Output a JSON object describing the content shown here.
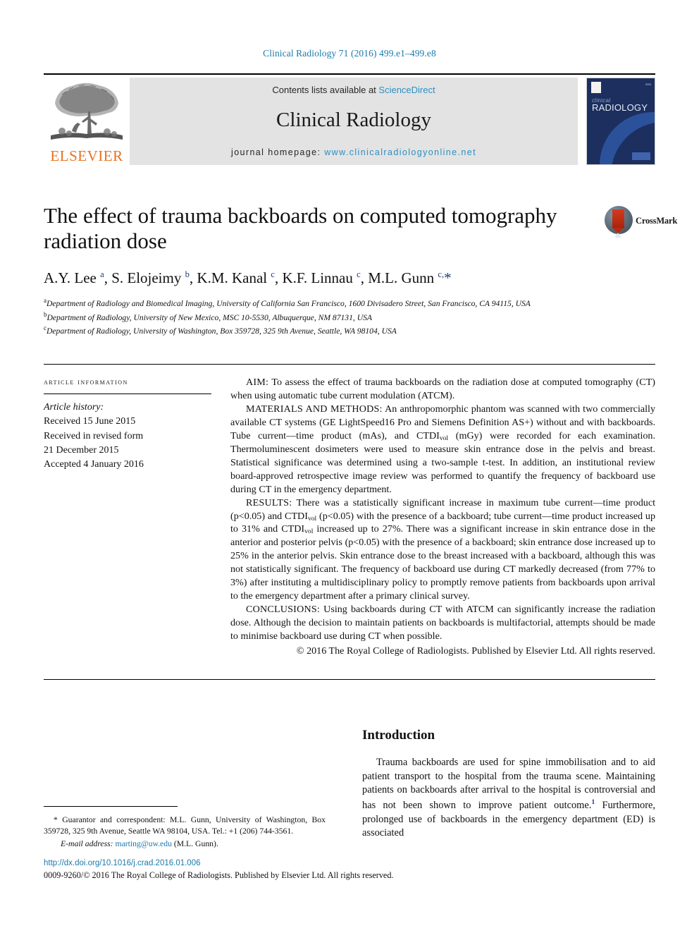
{
  "running_head": "Clinical Radiology 71 (2016) 499.e1–499.e8",
  "masthead": {
    "publisher_name": "ELSEVIER",
    "contents_prefix": "Contents lists available at ",
    "sciencedirect": "ScienceDirect",
    "journal_name": "Clinical Radiology",
    "homepage_prefix": "journal homepage: ",
    "homepage_url": "www.clinicalradiologyonline.net",
    "cover": {
      "title_small": "clinical",
      "title_large": "RADIOLOGY",
      "corner_text": "ISSN"
    }
  },
  "article": {
    "title": "The effect of trauma backboards on computed tomography radiation dose",
    "crossmark_label": "CrossMark",
    "authors_html": "A.Y. Lee <sup>a</sup>, S. Elojeimy <sup>b</sup>, K.M. Kanal <sup>c</sup>, K.F. Linnau <sup>c</sup>, M.L. Gunn <sup>c,</sup><span class=\"star\">*</span>",
    "affiliations": [
      "Department of Radiology and Biomedical Imaging, University of California San Francisco, 1600 Divisadero Street, San Francisco, CA 94115, USA",
      "Department of Radiology, University of New Mexico, MSC 10-5530, Albuquerque, NM 87131, USA",
      "Department of Radiology, University of Washington, Box 359728, 325 9th Avenue, Seattle, WA 98104, USA"
    ],
    "affiliation_marks": [
      "a",
      "b",
      "c"
    ]
  },
  "article_information": {
    "heading": "Article information",
    "history_label": "Article history:",
    "history": [
      "Received 15 June 2015",
      "Received in revised form",
      "21 December 2015",
      "Accepted 4 January 2016"
    ]
  },
  "abstract": {
    "aim_label": "AIM:",
    "aim_text": " To assess the effect of trauma backboards on the radiation dose at computed tomography (CT) when using automatic tube current modulation (ATCM).",
    "methods_label": "MATERIALS AND METHODS:",
    "methods_text_1": " An anthropomorphic phantom was scanned with two commercially available CT systems (GE LightSpeed16 Pro and Siemens Definition AS+) without and with backboards. Tube current—time product (mAs), and CTDI",
    "methods_sub_1": "vol",
    "methods_text_2": " (mGy) were recorded for each examination. Thermoluminescent dosimeters were used to measure skin entrance dose in the pelvis and breast. Statistical significance was determined using a two-sample t-test. In addition, an institutional review board-approved retrospective image review was performed to quantify the frequency of backboard use during CT in the emergency department.",
    "results_label": "RESULTS:",
    "results_text_1": " There was a statistically significant increase in maximum tube current—time product (p<0.05) and CTDI",
    "results_sub_1": "vol",
    "results_text_2": " (p<0.05) with the presence of a backboard; tube current—time product increased up to 31% and CTDI",
    "results_sub_2": "vol",
    "results_text_3": " increased up to 27%. There was a significant increase in skin entrance dose in the anterior and posterior pelvis (p<0.05) with the presence of a backboard; skin entrance dose increased up to 25% in the anterior pelvis. Skin entrance dose to the breast increased with a backboard, although this was not statistically significant. The frequency of backboard use during CT markedly decreased (from 77% to 3%) after instituting a multidisciplinary policy to promptly remove patients from backboards upon arrival to the emergency department after a primary clinical survey.",
    "conclusions_label": "CONCLUSIONS:",
    "conclusions_text": " Using backboards during CT with ATCM can significantly increase the radiation dose. Although the decision to maintain patients on backboards is multifactorial, attempts should be made to minimise backboard use during CT when possible.",
    "copyright": "© 2016 The Royal College of Radiologists. Published by Elsevier Ltd. All rights reserved."
  },
  "introduction": {
    "heading": "Introduction",
    "paragraph_1": "Trauma backboards are used for spine immobilisation and to aid patient transport to the hospital from the trauma scene. Maintaining patients on backboards after arrival to the hospital is controversial and has not been shown to improve patient outcome.",
    "citation_1": "1",
    "paragraph_1b": " Furthermore, prolonged use of backboards in the emergency department (ED) is associated"
  },
  "footnote": {
    "marker": "*",
    "correspondent": " Guarantor and correspondent: M.L. Gunn, University of Washington, Box 359728, 325 9th Avenue, Seattle WA 98104, USA. Tel.: +1 (206) 744-3561.",
    "email_label": "E-mail address:",
    "email": "marting@uw.edu",
    "email_suffix": " (M.L. Gunn)."
  },
  "footer": {
    "doi": "http://dx.doi.org/10.1016/j.crad.2016.01.006",
    "issn_copyright": "0009-9260/© 2016 The Royal College of Radiologists. Published by Elsevier Ltd. All rights reserved."
  },
  "colors": {
    "link_blue": "#1a7aab",
    "sciencedirect_blue": "#2b90c4",
    "elsevier_orange": "#E9711C",
    "cover_navy": "#1c2f5e",
    "crossmark_red": "#b82a12"
  }
}
